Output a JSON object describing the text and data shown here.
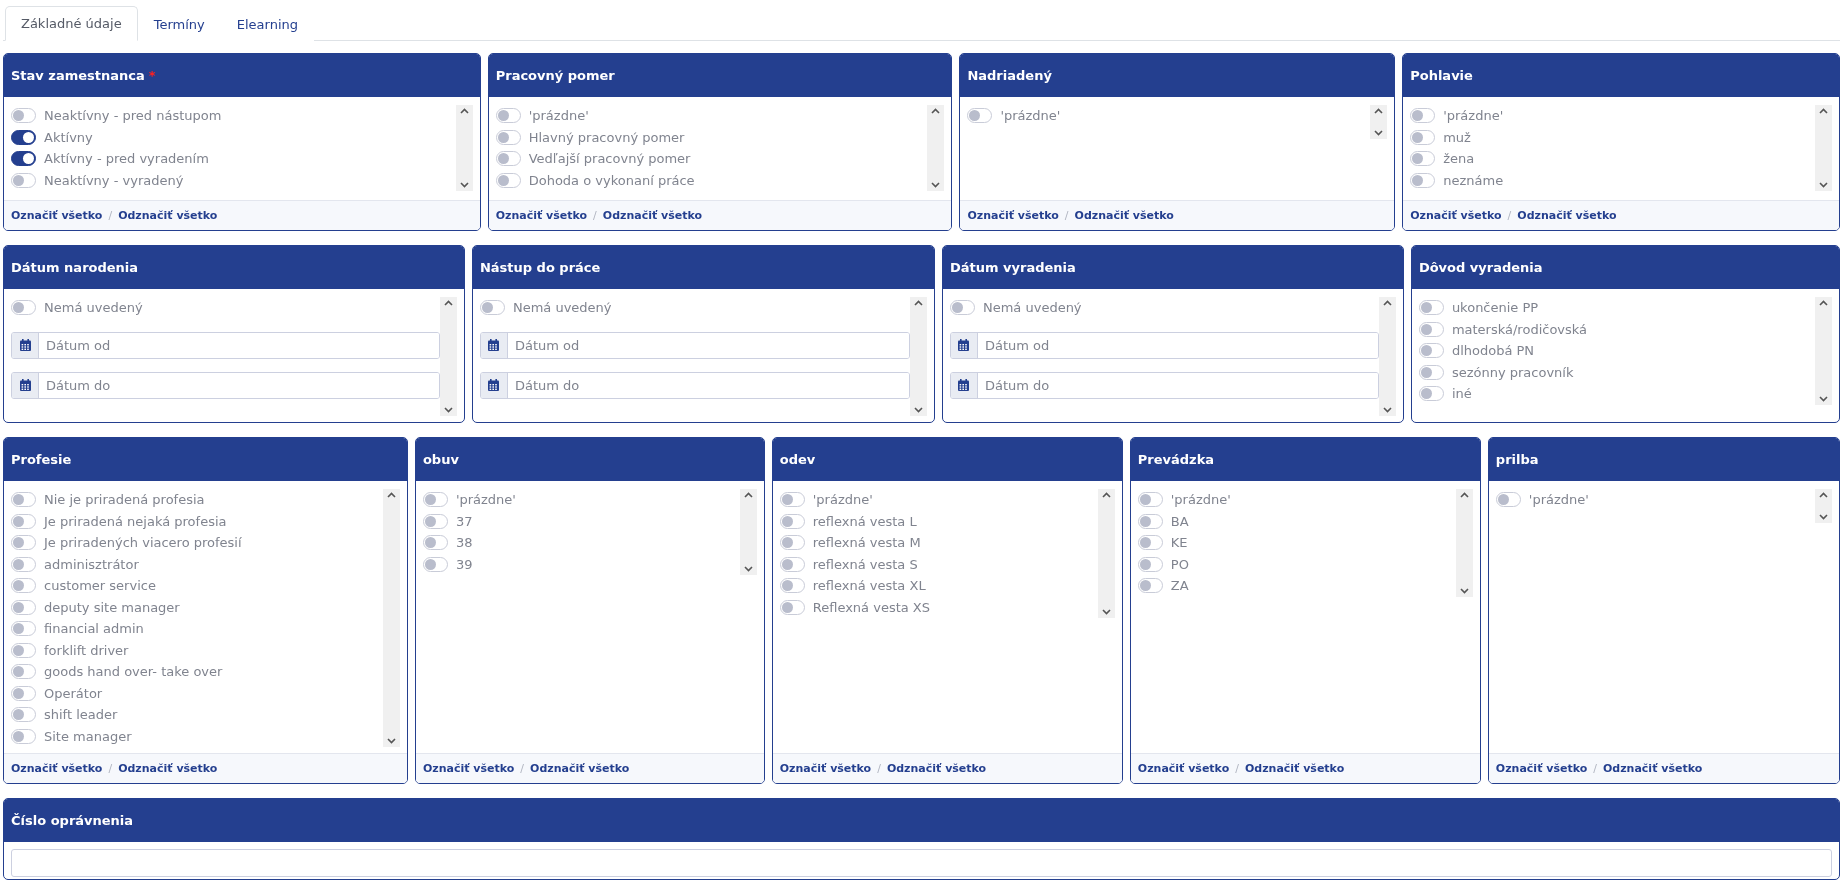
{
  "tabs": [
    {
      "label": "Základné údaje",
      "selected": true
    },
    {
      "label": "Termíny",
      "selected": false
    },
    {
      "label": "Elearning",
      "selected": false
    }
  ],
  "rows": [
    {
      "cards": [
        {
          "kind": "toggles",
          "title": "Stav zamestnanca",
          "required_mark": "*",
          "options": [
            {
              "label": "Neaktívny - pred nástupom",
              "on": false
            },
            {
              "label": "Aktívny",
              "on": true
            },
            {
              "label": "Aktívny - pred vyradením",
              "on": true
            },
            {
              "label": "Neaktívny - vyradený",
              "on": false
            }
          ],
          "select_all": "Označiť všetko",
          "separator": "/",
          "deselect_all": "Odznačiť všetko"
        },
        {
          "kind": "toggles",
          "title": "Pracovný pomer",
          "options": [
            {
              "label": "'prázdne'",
              "on": false
            },
            {
              "label": "Hlavný pracovný pomer",
              "on": false
            },
            {
              "label": "Vedľajší pracovný pomer",
              "on": false
            },
            {
              "label": "Dohoda o vykonaní práce",
              "on": false
            }
          ],
          "select_all": "Označiť všetko",
          "separator": "/",
          "deselect_all": "Odznačiť všetko"
        },
        {
          "kind": "toggles",
          "title": "Nadriadený",
          "options": [
            {
              "label": "'prázdne'",
              "on": false
            }
          ],
          "select_all": "Označiť všetko",
          "separator": "/",
          "deselect_all": "Odznačiť všetko"
        },
        {
          "kind": "toggles",
          "title": "Pohlavie",
          "options": [
            {
              "label": "'prázdne'",
              "on": false
            },
            {
              "label": "muž",
              "on": false
            },
            {
              "label": "žena",
              "on": false
            },
            {
              "label": "neznáme",
              "on": false
            }
          ],
          "select_all": "Označiť všetko",
          "separator": "/",
          "deselect_all": "Odznačiť všetko"
        }
      ]
    },
    {
      "cards": [
        {
          "kind": "dates",
          "title": "Dátum narodenia",
          "options": [
            {
              "label": "Nemá uvedený",
              "on": false
            }
          ],
          "from_placeholder": "Dátum od",
          "to_placeholder": "Dátum do"
        },
        {
          "kind": "dates",
          "title": "Nástup do práce",
          "options": [
            {
              "label": "Nemá uvedený",
              "on": false
            }
          ],
          "from_placeholder": "Dátum od",
          "to_placeholder": "Dátum do"
        },
        {
          "kind": "dates",
          "title": "Dátum vyradenia",
          "options": [
            {
              "label": "Nemá uvedený",
              "on": false
            }
          ],
          "from_placeholder": "Dátum od",
          "to_placeholder": "Dátum do"
        },
        {
          "kind": "toggles",
          "title": "Dôvod vyradenia",
          "options": [
            {
              "label": "ukončenie PP",
              "on": false
            },
            {
              "label": "materská/rodičovská",
              "on": false
            },
            {
              "label": "dlhodobá PN",
              "on": false
            },
            {
              "label": "sezónny pracovník",
              "on": false
            },
            {
              "label": "iné",
              "on": false
            }
          ]
        }
      ]
    },
    {
      "cards": [
        {
          "kind": "toggles",
          "title": "Profesie",
          "options": [
            {
              "label": "Nie je priradená profesia",
              "on": false
            },
            {
              "label": "Je priradená nejaká profesia",
              "on": false
            },
            {
              "label": "Je priradených viacero profesií",
              "on": false
            },
            {
              "label": "adminisztrátor",
              "on": false
            },
            {
              "label": "customer service",
              "on": false
            },
            {
              "label": "deputy site manager",
              "on": false
            },
            {
              "label": "financial admin",
              "on": false
            },
            {
              "label": "forklift driver",
              "on": false
            },
            {
              "label": "goods hand over- take over",
              "on": false
            },
            {
              "label": "Operátor",
              "on": false
            },
            {
              "label": "shift leader",
              "on": false
            },
            {
              "label": "Site manager",
              "on": false
            }
          ],
          "select_all": "Označiť všetko",
          "separator": "/",
          "deselect_all": "Odznačiť všetko"
        },
        {
          "kind": "toggles",
          "title": "obuv",
          "options": [
            {
              "label": "'prázdne'",
              "on": false
            },
            {
              "label": "37",
              "on": false
            },
            {
              "label": "38",
              "on": false
            },
            {
              "label": "39",
              "on": false
            }
          ],
          "select_all": "Označiť všetko",
          "separator": "/",
          "deselect_all": "Odznačiť všetko"
        },
        {
          "kind": "toggles",
          "title": "odev",
          "options": [
            {
              "label": "'prázdne'",
              "on": false
            },
            {
              "label": "reflexná vesta L",
              "on": false
            },
            {
              "label": "reflexná vesta M",
              "on": false
            },
            {
              "label": "reflexná vesta S",
              "on": false
            },
            {
              "label": "reflexná vesta XL",
              "on": false
            },
            {
              "label": "Reflexná vesta XS",
              "on": false
            }
          ],
          "select_all": "Označiť všetko",
          "separator": "/",
          "deselect_all": "Odznačiť všetko"
        },
        {
          "kind": "toggles",
          "title": "Prevádzka",
          "options": [
            {
              "label": "'prázdne'",
              "on": false
            },
            {
              "label": "BA",
              "on": false
            },
            {
              "label": "KE",
              "on": false
            },
            {
              "label": "PO",
              "on": false
            },
            {
              "label": "ZA",
              "on": false
            }
          ],
          "select_all": "Označiť všetko",
          "separator": "/",
          "deselect_all": "Odznačiť všetko"
        },
        {
          "kind": "toggles",
          "title": "prilba",
          "options": [
            {
              "label": "'prázdne'",
              "on": false
            }
          ],
          "select_all": "Označiť všetko",
          "separator": "/",
          "deselect_all": "Odznačiť všetko"
        }
      ]
    },
    {
      "cards": [
        {
          "kind": "text",
          "title": "Číslo oprávnenia"
        }
      ]
    }
  ]
}
